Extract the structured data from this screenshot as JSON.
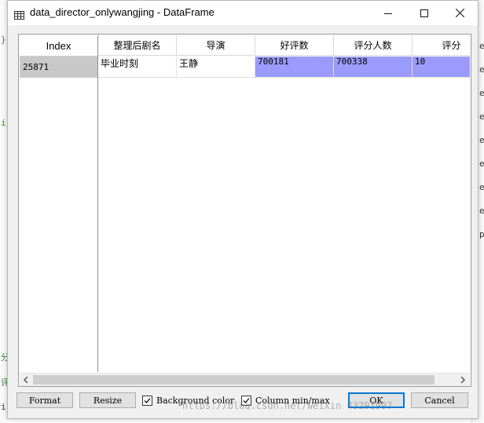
{
  "window": {
    "title": "data_director_onlywangjing - DataFrame",
    "icon": "table-icon",
    "controls": [
      "minimize-icon",
      "maximize-icon",
      "close-icon"
    ]
  },
  "table": {
    "index_header": "Index",
    "columns": [
      "整理后剧名",
      "导演",
      "好评数",
      "评分人数",
      "评分"
    ],
    "rows": [
      {
        "index": "25871",
        "cells": [
          "毕业时刻",
          "王静",
          "700181",
          "700338",
          "10"
        ]
      }
    ],
    "highlight_color": "#9b9bfb"
  },
  "footer": {
    "format_label": "Format",
    "resize_label": "Resize",
    "background_color_label": "Background color",
    "background_color_checked": true,
    "column_minmax_label": "Column min/max",
    "column_minmax_checked": true,
    "ok_label": "OK",
    "cancel_label": "Cancel"
  },
  "background": {
    "watermark": "https://blog.csdn.net/weixin_43291997",
    "left_edge_glyphs": [
      "}",
      "ij",
      "分",
      "评",
      "ir"
    ],
    "right_edge_glyphs": [
      "e",
      "e",
      "e",
      "e",
      "e",
      "e",
      "e",
      "e",
      "p"
    ]
  }
}
